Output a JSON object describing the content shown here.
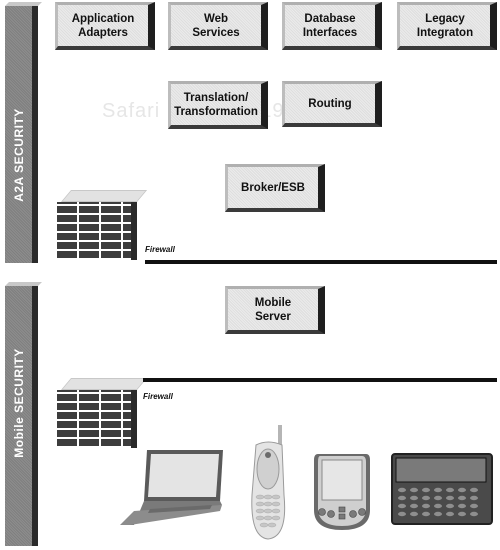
{
  "diagram": {
    "zones": [
      {
        "label": "A2A SECURITY"
      },
      {
        "label": "Mobile SECURITY"
      }
    ],
    "components": {
      "app_adapters": "Application\nAdapters",
      "web_services": "Web\nServices",
      "database_interfaces": "Database\nInterfaces",
      "legacy_integration": "Legacy\nIntegraton",
      "translation": "Translation/\nTransformation",
      "routing": "Routing",
      "broker": "Broker/ESB",
      "mobile_server": "Mobile\nServer"
    },
    "firewalls": [
      {
        "label": "Firewall"
      },
      {
        "label": "Firewall"
      }
    ],
    "devices": [
      "laptop",
      "mobile-phone",
      "pda",
      "pager"
    ],
    "watermark": "Safari ... 07329/1978"
  }
}
